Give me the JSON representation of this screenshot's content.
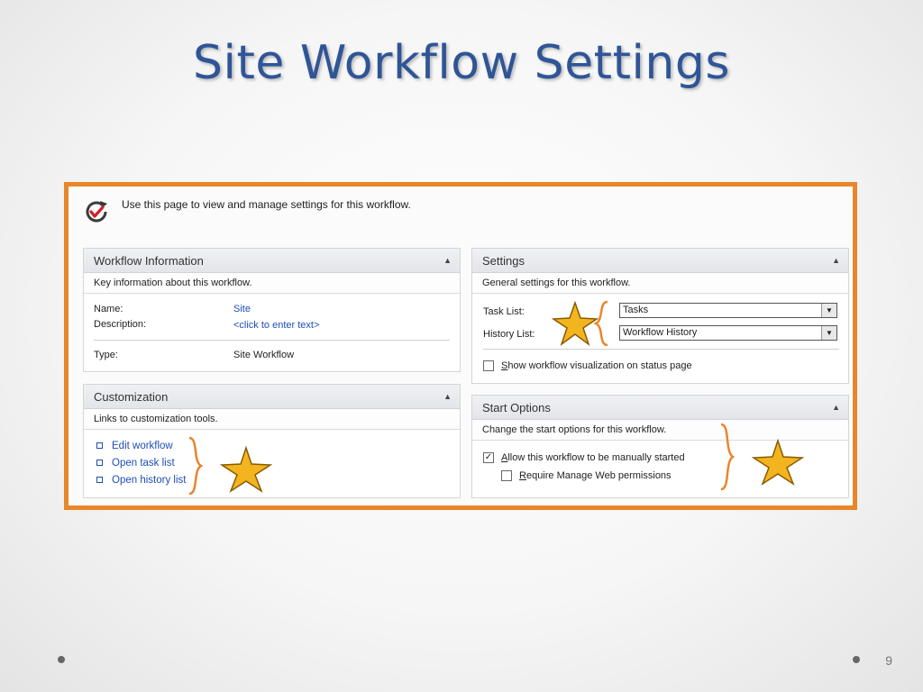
{
  "slide": {
    "title": "Site Workflow Settings",
    "page_number": "9"
  },
  "intro": {
    "text": "Use this page to view and manage settings for this workflow.",
    "icon": "workflow-check-icon"
  },
  "workflow_info": {
    "title": "Workflow Information",
    "description": "Key information about this workflow.",
    "name_label": "Name:",
    "name_value": "Site",
    "description_label": "Description:",
    "description_value": "<click to enter text>",
    "type_label": "Type:",
    "type_value": "Site Workflow"
  },
  "customization": {
    "title": "Customization",
    "description": "Links to customization tools.",
    "links": [
      "Edit workflow",
      "Open task list",
      "Open history list"
    ]
  },
  "settings": {
    "title": "Settings",
    "description": "General settings for this workflow.",
    "task_list_label": "Task List:",
    "task_list_value": "Tasks",
    "history_list_label": "History List:",
    "history_list_value": "Workflow History",
    "show_viz_prefix": "S",
    "show_viz_rest": "how workflow visualization on status page",
    "show_viz_checked": false
  },
  "start_options": {
    "title": "Start Options",
    "description": "Change the start options for this workflow.",
    "allow_prefix": "A",
    "allow_rest": "llow this workflow to be manually started",
    "allow_checked": true,
    "require_prefix": "R",
    "require_rest": "equire Manage Web permissions",
    "require_checked": false
  },
  "colors": {
    "accent_orange": "#e8862a",
    "title_blue": "#2f5597",
    "link_blue": "#1f4eb4"
  }
}
